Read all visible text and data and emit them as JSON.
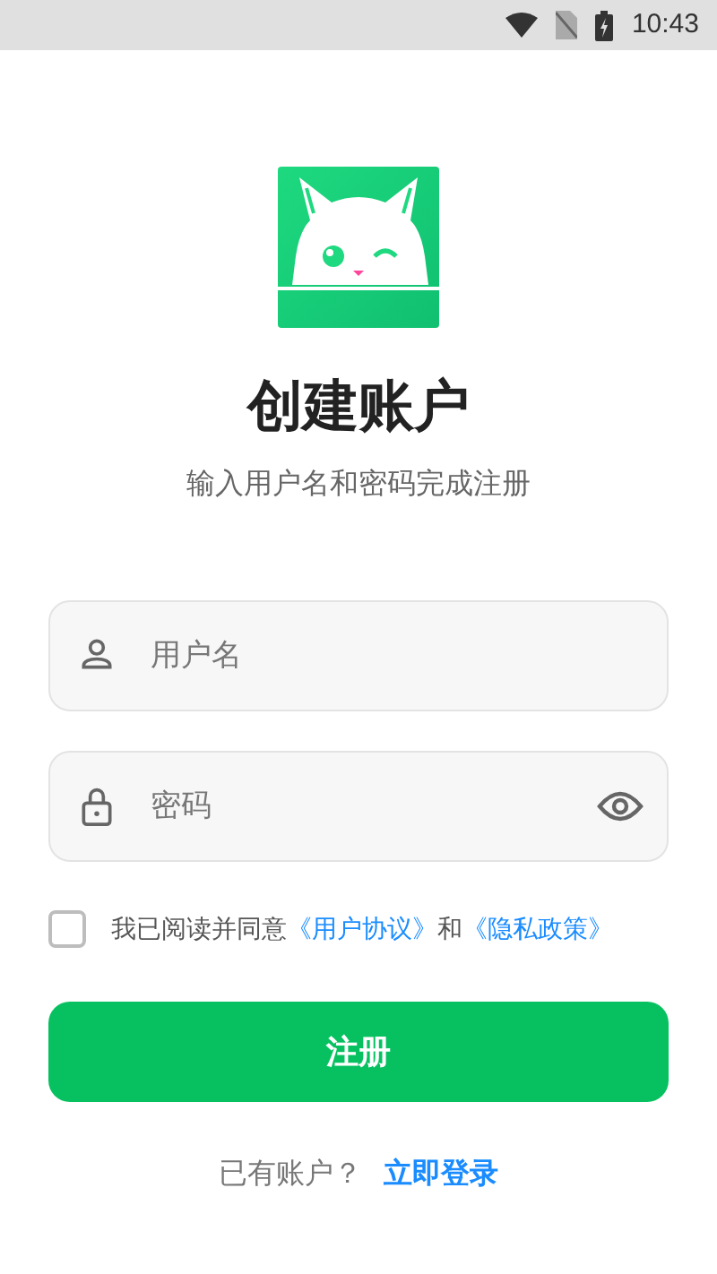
{
  "status_bar": {
    "time": "10:43"
  },
  "title": "创建账户",
  "subtitle": "输入用户名和密码完成注册",
  "fields": [
    {
      "kind": "user",
      "placeholder": "用户名"
    },
    {
      "kind": "password",
      "placeholder": "密码"
    }
  ],
  "agreement": {
    "checked": false,
    "text": "我已阅读并同意",
    "link_1": "《用户协议》",
    "and": "和",
    "link_2": "《隐私政策》"
  },
  "submit": "注册",
  "footer": {
    "text": "已有账户？",
    "link": "立即登录"
  }
}
